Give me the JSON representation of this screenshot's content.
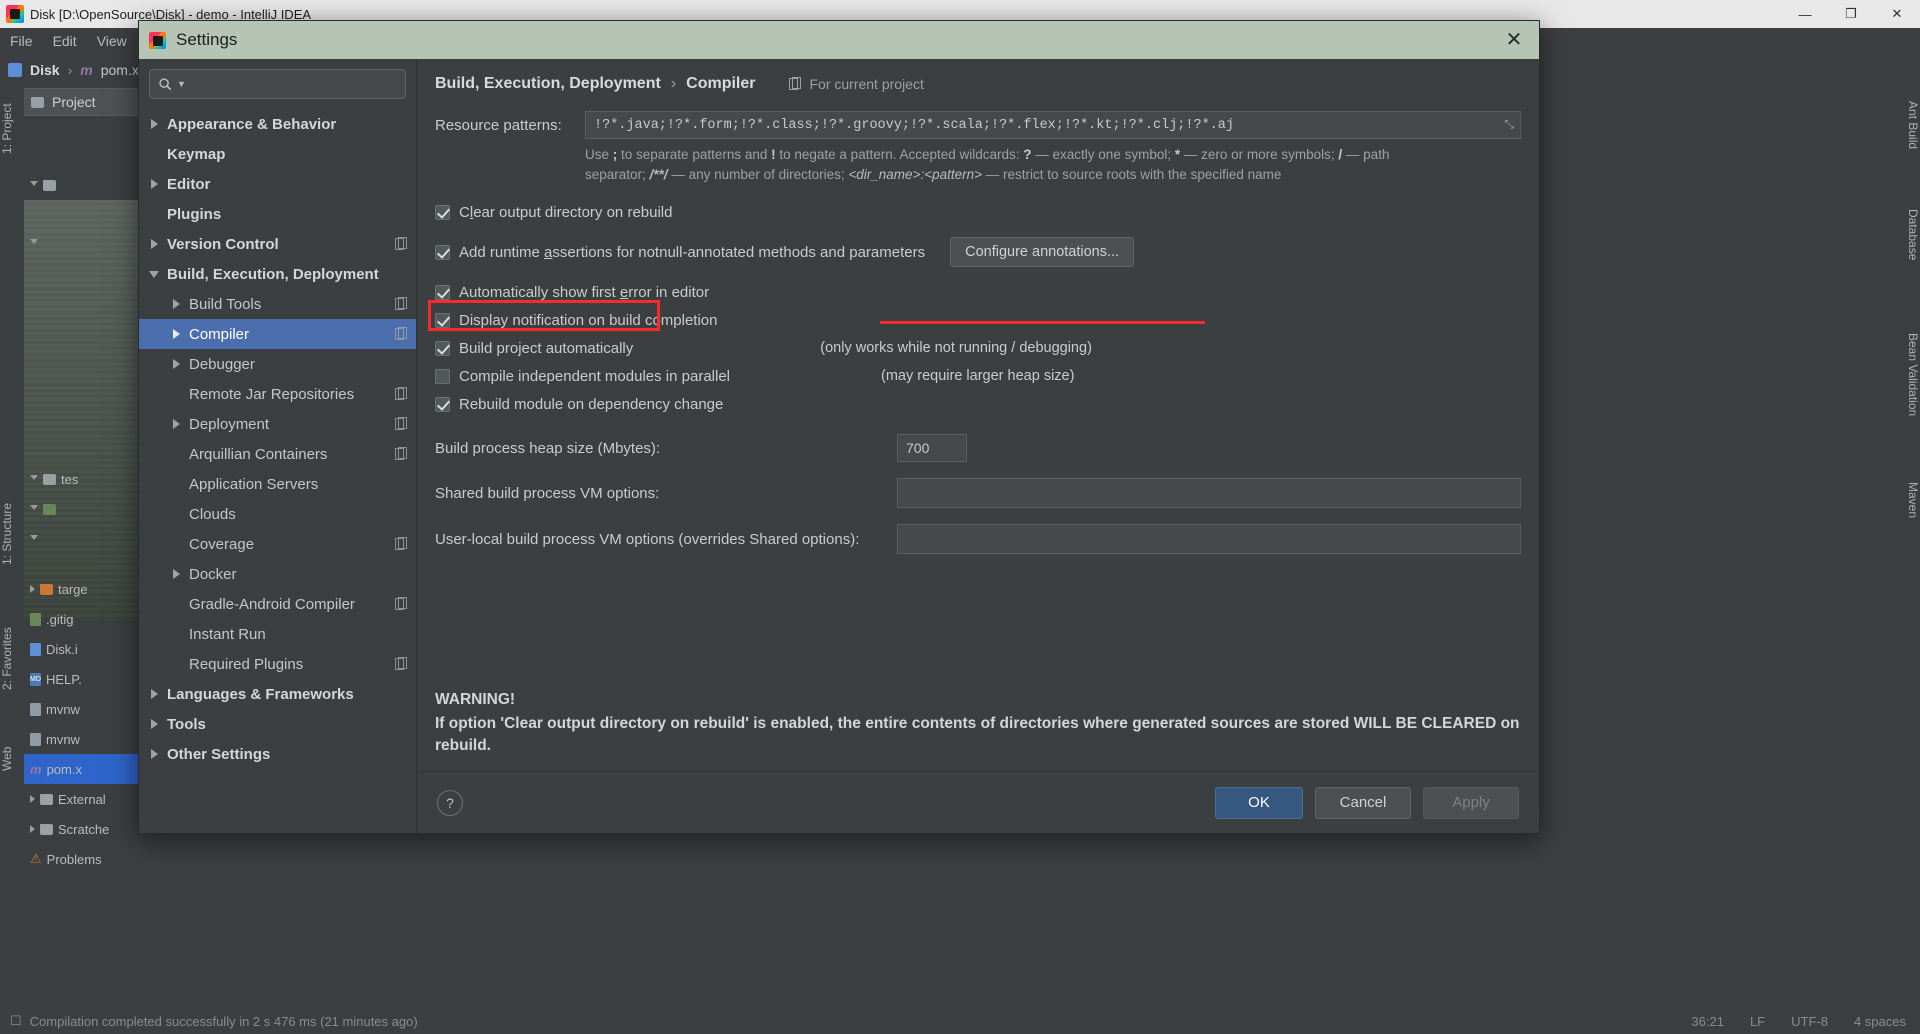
{
  "ide": {
    "window_title": "Disk [D:\\OpenSource\\Disk] - demo - IntelliJ IDEA",
    "menu": [
      "File",
      "Edit",
      "View"
    ],
    "breadcrumb": [
      "Disk",
      "pom.xml"
    ],
    "project_tab": "Project",
    "left_tabs": [
      "1: Project",
      "1: Structure",
      "2: Favorites",
      "Web"
    ],
    "right_tabs": [
      "Ant Build",
      "Database",
      "Bean Validation",
      "Maven"
    ],
    "status_text": "Compilation completed successfully in 2 s 476 ms (21 minutes ago)",
    "status_right": [
      "36:21",
      "LF",
      "UTF-8",
      "4 spaces"
    ],
    "project_files": [
      "tes",
      "targe",
      ".gitig",
      "Disk.i",
      "HELP.",
      "mvnw",
      "mvnw",
      "pom.x",
      "External",
      "Scratche",
      "Problems"
    ],
    "window_buttons": [
      "—",
      "❐",
      "✕"
    ]
  },
  "dialog": {
    "title": "Settings",
    "close_label": "✕",
    "search": {
      "value": "",
      "placeholder": ""
    },
    "tree": [
      {
        "label": "Appearance & Behavior",
        "level": 0,
        "bold": true,
        "arrow": "right",
        "selected": false,
        "badge": false
      },
      {
        "label": "Keymap",
        "level": 0,
        "bold": true,
        "arrow": "none",
        "selected": false,
        "badge": false
      },
      {
        "label": "Editor",
        "level": 0,
        "bold": true,
        "arrow": "right",
        "selected": false,
        "badge": false
      },
      {
        "label": "Plugins",
        "level": 0,
        "bold": true,
        "arrow": "none",
        "selected": false,
        "badge": false
      },
      {
        "label": "Version Control",
        "level": 0,
        "bold": true,
        "arrow": "right",
        "selected": false,
        "badge": true
      },
      {
        "label": "Build, Execution, Deployment",
        "level": 0,
        "bold": true,
        "arrow": "down",
        "selected": false,
        "badge": false
      },
      {
        "label": "Build Tools",
        "level": 1,
        "bold": false,
        "arrow": "right",
        "selected": false,
        "badge": true
      },
      {
        "label": "Compiler",
        "level": 1,
        "bold": false,
        "arrow": "right",
        "selected": true,
        "badge": true
      },
      {
        "label": "Debugger",
        "level": 1,
        "bold": false,
        "arrow": "right",
        "selected": false,
        "badge": false
      },
      {
        "label": "Remote Jar Repositories",
        "level": 1,
        "bold": false,
        "arrow": "none",
        "selected": false,
        "badge": true
      },
      {
        "label": "Deployment",
        "level": 1,
        "bold": false,
        "arrow": "right",
        "selected": false,
        "badge": true
      },
      {
        "label": "Arquillian Containers",
        "level": 1,
        "bold": false,
        "arrow": "none",
        "selected": false,
        "badge": true
      },
      {
        "label": "Application Servers",
        "level": 1,
        "bold": false,
        "arrow": "none",
        "selected": false,
        "badge": false
      },
      {
        "label": "Clouds",
        "level": 1,
        "bold": false,
        "arrow": "none",
        "selected": false,
        "badge": false
      },
      {
        "label": "Coverage",
        "level": 1,
        "bold": false,
        "arrow": "none",
        "selected": false,
        "badge": true
      },
      {
        "label": "Docker",
        "level": 1,
        "bold": false,
        "arrow": "right",
        "selected": false,
        "badge": false
      },
      {
        "label": "Gradle-Android Compiler",
        "level": 1,
        "bold": false,
        "arrow": "none",
        "selected": false,
        "badge": true
      },
      {
        "label": "Instant Run",
        "level": 1,
        "bold": false,
        "arrow": "none",
        "selected": false,
        "badge": false
      },
      {
        "label": "Required Plugins",
        "level": 1,
        "bold": false,
        "arrow": "none",
        "selected": false,
        "badge": true
      },
      {
        "label": "Languages & Frameworks",
        "level": 0,
        "bold": true,
        "arrow": "right",
        "selected": false,
        "badge": false
      },
      {
        "label": "Tools",
        "level": 0,
        "bold": true,
        "arrow": "right",
        "selected": false,
        "badge": false
      },
      {
        "label": "Other Settings",
        "level": 0,
        "bold": true,
        "arrow": "right",
        "selected": false,
        "badge": false
      }
    ],
    "breadcrumb": {
      "parent": "Build, Execution, Deployment",
      "separator": "›",
      "current": "Compiler"
    },
    "for_current_project": "For current project",
    "resource_patterns": {
      "label": "Resource patterns:",
      "value": "!?*.java;!?*.form;!?*.class;!?*.groovy;!?*.scala;!?*.flex;!?*.kt;!?*.clj;!?*.aj",
      "expand_icon": "⤡"
    },
    "hint": {
      "line1_a": "Use ",
      "line1_semi": ";",
      "line1_b": " to separate patterns and ",
      "line1_bang": "!",
      "line1_c": " to negate a pattern. Accepted wildcards: ",
      "line1_q": "?",
      "line1_d": " — exactly one symbol; ",
      "line1_star": "*",
      "line1_e": " — zero or more symbols; ",
      "line1_slash": "/",
      "line1_f": " — path",
      "line2_a": "separator; ",
      "line2_glob": "/**/",
      "line2_b": " — any number of directories; ",
      "line2_dir": "<dir_name>:<pattern>",
      "line2_c": " — restrict to source roots with the specified name"
    },
    "checkboxes": [
      {
        "label_pre": "C",
        "mnemonic": "l",
        "label_post": "ear output directory on rebuild",
        "checked": true
      },
      {
        "label_pre": "Add runtime ",
        "mnemonic": "a",
        "label_post": "ssertions for notnull-annotated methods and parameters",
        "checked": true
      },
      {
        "label_pre": "Automatically show first ",
        "mnemonic": "e",
        "label_post": "rror in editor",
        "checked": true
      },
      {
        "label_pre": "Display notification on build completion",
        "mnemonic": "",
        "label_post": "",
        "checked": true
      },
      {
        "label_pre": "Build project automatically",
        "mnemonic": "",
        "label_post": "",
        "checked": true
      },
      {
        "label_pre": "Compile independent modules in parallel",
        "mnemonic": "",
        "label_post": "",
        "checked": false
      },
      {
        "label_pre": "Rebuild module on dependency change",
        "mnemonic": "",
        "label_post": "",
        "checked": true
      }
    ],
    "configure_annotations_button": "Configure annotations...",
    "note_build_auto": "(only works while not running / debugging)",
    "note_parallel": "(may require larger heap size)",
    "heap": {
      "label": "Build process heap size (Mbytes):",
      "value": "700"
    },
    "shared_vm": {
      "label": "Shared build process VM options:",
      "value": ""
    },
    "user_vm": {
      "label": "User-local build process VM options (overrides Shared options):",
      "value": ""
    },
    "warning": {
      "title": "WARNING!",
      "line1": "If option 'Clear output directory on rebuild' is enabled, the entire contents of directories where generated sources are stored WILL BE CLEARED on",
      "line2": "rebuild."
    },
    "footer": {
      "help": "?",
      "ok": "OK",
      "cancel": "Cancel",
      "apply": "Apply"
    }
  },
  "colors": {
    "accent_blue": "#4b6eaf",
    "ok_button": "#365880",
    "annotation_red": "#fb2b2b",
    "dialog_titlebar": "#b6c4b6",
    "panel_bg": "#3c3f41"
  }
}
